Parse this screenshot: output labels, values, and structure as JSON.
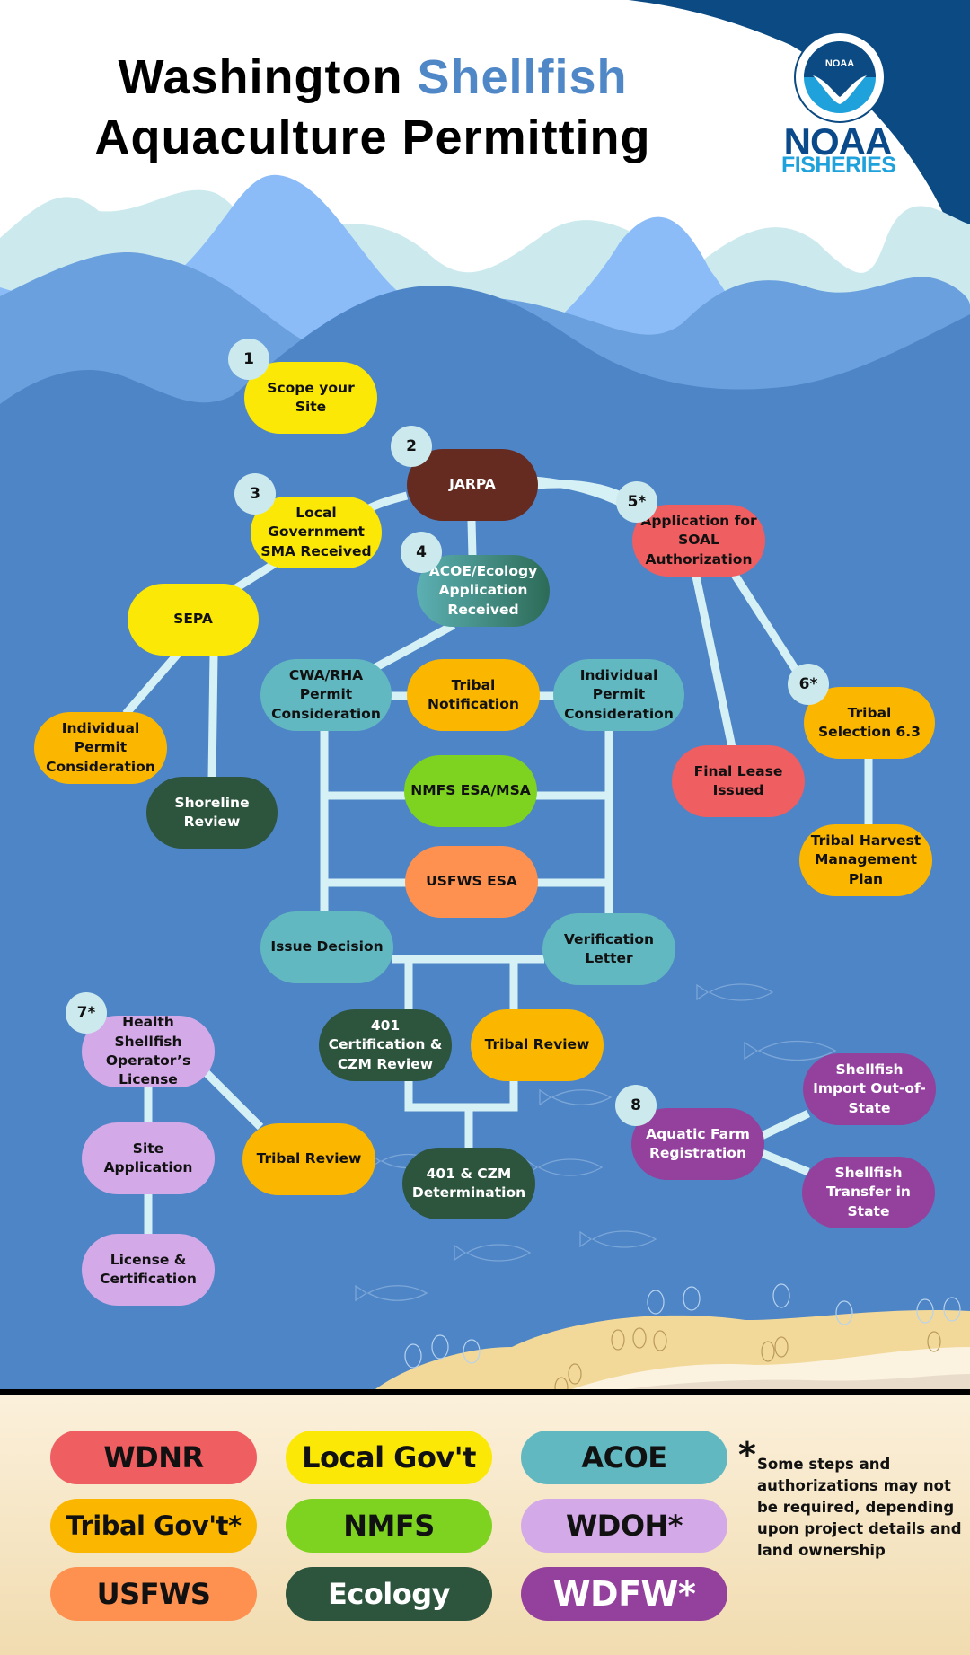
{
  "header": {
    "title_part1": "Washington ",
    "title_accent": "Shellfish",
    "title_line2": "Aquaculture Permitting",
    "logo_emblem_text": "NOAA",
    "logo_word1": "NOAA",
    "logo_word2": "FISHERIES"
  },
  "colors": {
    "WDNR": "#ef5e61",
    "LocalGov": "#fbe806",
    "ACOE": "#62b8c1",
    "TribalGov": "#fbb700",
    "NMFS": "#7ed321",
    "WDOH": "#d4a9e8",
    "USFWS": "#fe9050",
    "Ecology": "#2d543d",
    "WDFW": "#93419c",
    "JARPA": "#662b20",
    "water": "#4e85c6",
    "connector": "#d6f1f5",
    "badge": "#cceaee"
  },
  "steps": [
    {
      "id": "scope",
      "badge": "1",
      "label": "Scope your Site",
      "agency": "LocalGov"
    },
    {
      "id": "jarpa",
      "badge": "2",
      "label": "JARPA",
      "agency": "JARPA"
    },
    {
      "id": "local-sma",
      "badge": "3",
      "label": "Local Government SMA Received",
      "agency": "LocalGov"
    },
    {
      "id": "acoe-ecology",
      "badge": "4",
      "label": "ACOE/Ecology Application Received",
      "agency": "ACOE"
    },
    {
      "id": "soal",
      "badge": "5*",
      "label": "Application for SOAL Authorization",
      "agency": "WDNR"
    },
    {
      "id": "sepa",
      "badge": "",
      "label": "SEPA",
      "agency": "LocalGov"
    },
    {
      "id": "individual-permit-left",
      "badge": "",
      "label": "Individual Permit Consideration",
      "agency": "TribalGov"
    },
    {
      "id": "shoreline-review",
      "badge": "",
      "label": "Shoreline Review",
      "agency": "Ecology"
    },
    {
      "id": "cwa-rha",
      "badge": "",
      "label": "CWA/RHA Permit Consideration",
      "agency": "ACOE"
    },
    {
      "id": "tribal-notification",
      "badge": "",
      "label": "Tribal Notification",
      "agency": "TribalGov"
    },
    {
      "id": "individual-permit-right",
      "badge": "",
      "label": "Individual Permit Consideration",
      "agency": "ACOE"
    },
    {
      "id": "nmfs-esa",
      "badge": "",
      "label": "NMFS ESA/MSA",
      "agency": "NMFS"
    },
    {
      "id": "usfws-esa",
      "badge": "",
      "label": "USFWS ESA",
      "agency": "USFWS"
    },
    {
      "id": "issue-decision",
      "badge": "",
      "label": "Issue Decision",
      "agency": "ACOE"
    },
    {
      "id": "verification-letter",
      "badge": "",
      "label": "Verification Letter",
      "agency": "ACOE"
    },
    {
      "id": "cert-401",
      "badge": "",
      "label": "401 Certification & CZM Review",
      "agency": "Ecology"
    },
    {
      "id": "tribal-review-mid",
      "badge": "",
      "label": "Tribal Review",
      "agency": "TribalGov"
    },
    {
      "id": "determination-401",
      "badge": "",
      "label": "401 & CZM Determination",
      "agency": "Ecology"
    },
    {
      "id": "final-lease",
      "badge": "",
      "label": "Final Lease Issued",
      "agency": "WDNR"
    },
    {
      "id": "tribal-selection",
      "badge": "6*",
      "label": "Tribal Selection 6.3",
      "agency": "TribalGov"
    },
    {
      "id": "tribal-harvest",
      "badge": "",
      "label": "Tribal Harvest Management Plan",
      "agency": "TribalGov"
    },
    {
      "id": "health-license",
      "badge": "7*",
      "label": "Health Shellfish Operator’s License",
      "agency": "WDOH"
    },
    {
      "id": "site-application",
      "badge": "",
      "label": "Site Application",
      "agency": "WDOH"
    },
    {
      "id": "license-cert",
      "badge": "",
      "label": "License & Certification",
      "agency": "WDOH"
    },
    {
      "id": "tribal-review-left",
      "badge": "",
      "label": "Tribal Review",
      "agency": "TribalGov"
    },
    {
      "id": "aquatic-farm",
      "badge": "8",
      "label": "Aquatic Farm Registration",
      "agency": "WDFW"
    },
    {
      "id": "shellfish-import",
      "badge": "",
      "label": "Shellfish Import Out-of-State",
      "agency": "WDFW"
    },
    {
      "id": "shellfish-transfer",
      "badge": "",
      "label": "Shellfish Transfer in State",
      "agency": "WDFW"
    }
  ],
  "connections": [
    [
      "jarpa",
      "local-sma"
    ],
    [
      "jarpa",
      "soal"
    ],
    [
      "jarpa",
      "acoe-ecology"
    ],
    [
      "local-sma",
      "sepa"
    ],
    [
      "sepa",
      "individual-permit-left"
    ],
    [
      "sepa",
      "shoreline-review"
    ],
    [
      "acoe-ecology",
      "cwa-rha"
    ],
    [
      "cwa-rha",
      "tribal-notification"
    ],
    [
      "tribal-notification",
      "individual-permit-right"
    ],
    [
      "cwa-rha",
      "issue-decision"
    ],
    [
      "individual-permit-right",
      "verification-letter"
    ],
    [
      "nmfs-esa",
      "cwa-rha"
    ],
    [
      "nmfs-esa",
      "individual-permit-right"
    ],
    [
      "usfws-esa",
      "cwa-rha"
    ],
    [
      "usfws-esa",
      "individual-permit-right"
    ],
    [
      "issue-decision",
      "verification-letter"
    ],
    [
      "issue-decision",
      "cert-401"
    ],
    [
      "issue-decision",
      "tribal-review-mid"
    ],
    [
      "cert-401",
      "determination-401"
    ],
    [
      "tribal-review-mid",
      "determination-401"
    ],
    [
      "soal",
      "final-lease"
    ],
    [
      "soal",
      "tribal-selection"
    ],
    [
      "tribal-selection",
      "tribal-harvest"
    ],
    [
      "health-license",
      "site-application"
    ],
    [
      "site-application",
      "license-cert"
    ],
    [
      "health-license",
      "tribal-review-left"
    ],
    [
      "aquatic-farm",
      "shellfish-import"
    ],
    [
      "aquatic-farm",
      "shellfish-transfer"
    ]
  ],
  "legend": {
    "items": [
      {
        "label": "WDNR",
        "agency": "WDNR"
      },
      {
        "label": "Local Gov't",
        "agency": "LocalGov"
      },
      {
        "label": "ACOE",
        "agency": "ACOE"
      },
      {
        "label": "Tribal Gov't*",
        "agency": "TribalGov"
      },
      {
        "label": "NMFS",
        "agency": "NMFS"
      },
      {
        "label": "WDOH*",
        "agency": "WDOH"
      },
      {
        "label": "USFWS",
        "agency": "USFWS"
      },
      {
        "label": "Ecology",
        "agency": "Ecology"
      },
      {
        "label": "WDFW*",
        "agency": "WDFW"
      }
    ],
    "footnote_mark": "*",
    "footnote": "Some steps and authorizations may not be required, depending upon project details and land ownership"
  }
}
